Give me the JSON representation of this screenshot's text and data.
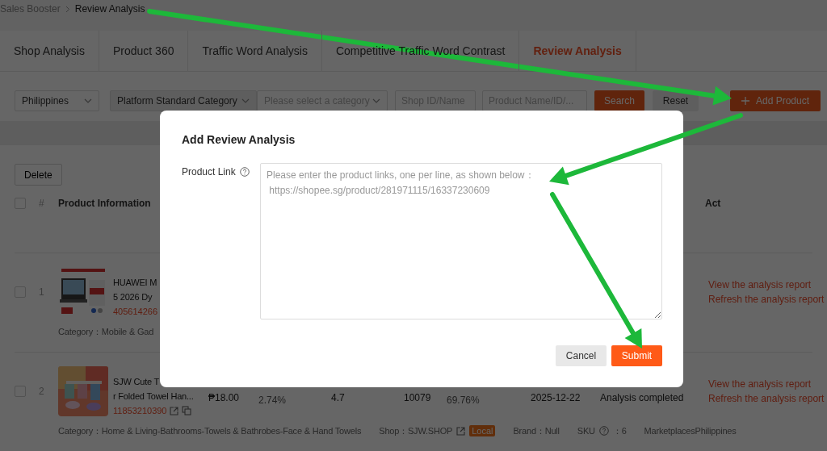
{
  "breadcrumb": [
    {
      "label": "Sales Booster",
      "current": false
    },
    {
      "label": "Review Analysis",
      "current": true
    }
  ],
  "tabs": [
    {
      "label": "Shop Analysis",
      "selected": false
    },
    {
      "label": "Product 360",
      "selected": false
    },
    {
      "label": "Traffic Word Analysis",
      "selected": false
    },
    {
      "label": "Competitive Traffic Word Contrast",
      "selected": false
    },
    {
      "label": "Review Analysis",
      "selected": true
    }
  ],
  "filters": {
    "country": {
      "value": "Philippines"
    },
    "category_type": {
      "value": "Platform Standard Category"
    },
    "category": {
      "placeholder": "Please select a category"
    },
    "shop": {
      "placeholder": "Shop ID/Name"
    },
    "product": {
      "placeholder": "Product Name/ID/..."
    }
  },
  "toolbar_buttons": {
    "search": "Search",
    "reset": "Reset",
    "add_product": "Add Product"
  },
  "delete_button": "Delete",
  "table": {
    "columns": [
      "#",
      "Product Information",
      "Act"
    ],
    "header_checked": false,
    "rows": [
      {
        "index": "1",
        "checked": false,
        "title_lines": [
          "HUAWEI M",
          "5 2026 Dy"
        ],
        "product_id": "405614266",
        "values": [],
        "details": {
          "category": "Category：Mobile & Gad"
        },
        "actions": [
          "View the analysis report",
          "Refresh the analysis report"
        ]
      },
      {
        "index": "2",
        "checked": false,
        "title_lines": [
          "SJW Cute T",
          "r Folded Towel Han..."
        ],
        "product_id": "11853210390",
        "id_icons": true,
        "values": [
          "₱18.00",
          "2.74%",
          "4.7",
          "10079",
          "69.76%",
          "2025-12-22",
          "Analysis completed"
        ],
        "details": {
          "category": "Category：Home & Living-Bathrooms-Towels & Bathrobes-Face & Hand Towels",
          "shop": "Shop：SJW.SHOP",
          "badge": "Local",
          "brand": "Brand：Null",
          "sku_label": "SKU",
          "sku_value": "：6",
          "marketplace": "MarketplacesPhilippines"
        },
        "actions": [
          "View the analysis report",
          "Refresh the analysis report"
        ]
      }
    ]
  },
  "modal": {
    "title": "Add Review Analysis",
    "field_label": "Product Link",
    "placeholder": "Please enter the product links, one per line, as shown below：\n https://shopee.sg/product/281971115/16337230609",
    "buttons": [
      {
        "label": "Cancel",
        "kind": "secondary"
      },
      {
        "label": "Submit",
        "kind": "primary"
      }
    ]
  }
}
